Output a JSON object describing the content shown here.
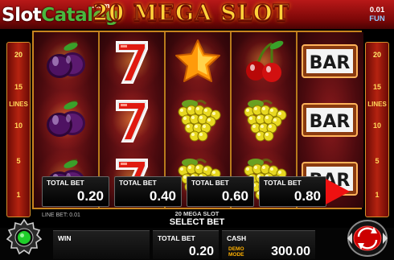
{
  "header": {
    "watermark_part1": "Slot",
    "watermark_part2": "Catalog",
    "watermark_suffix": ".com",
    "game_logo": "20 MEGA SLOT",
    "denomination": "0.01",
    "mode": "FUN"
  },
  "side_panel": {
    "word": "LINES",
    "numbers": [
      "20",
      "15",
      "10",
      "5",
      "1"
    ]
  },
  "reels": [
    [
      "plum",
      "plum",
      "plum"
    ],
    [
      "seven",
      "seven",
      "seven"
    ],
    [
      "star",
      "grapes",
      "grapes"
    ],
    [
      "cherry",
      "grapes",
      "grapes"
    ],
    [
      "bar",
      "bar",
      "bar"
    ]
  ],
  "bar_text": "BAR",
  "bet_options": [
    {
      "label": "TOTAL BET",
      "value": "0.20"
    },
    {
      "label": "TOTAL BET",
      "value": "0.40"
    },
    {
      "label": "TOTAL BET",
      "value": "0.60"
    },
    {
      "label": "TOTAL BET",
      "value": "0.80"
    }
  ],
  "play_icon": "play-arrow-icon",
  "footer": {
    "line_bet": "LINE BET: 0.01",
    "game_name": "20 MEGA SLOT",
    "select_bet": "SELECT BET",
    "win_label": "WIN",
    "win_value": "",
    "total_bet_label": "TOTAL BET",
    "total_bet_value": "0.20",
    "cash_label": "CASH",
    "cash_value": "300.00",
    "demo_mode_line1": "DEMO",
    "demo_mode_line2": "MODE"
  },
  "colors": {
    "accent_red": "#e11111",
    "gold": "#ffd23a",
    "status_green": "#1fcf2a"
  }
}
